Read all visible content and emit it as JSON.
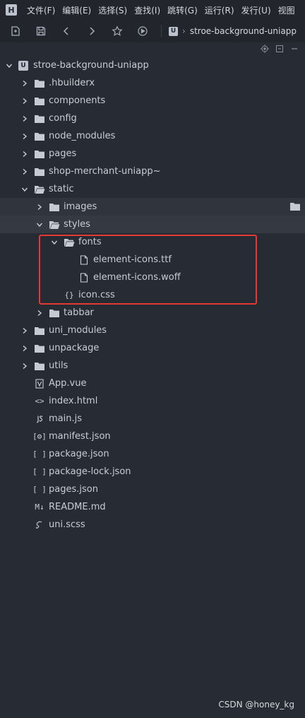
{
  "menu": {
    "logo_glyph": "H",
    "items": [
      "文件(F)",
      "编辑(E)",
      "选择(S)",
      "查找(I)",
      "跳转(G)",
      "运行(R)",
      "发行(U)",
      "视图"
    ]
  },
  "toolbar": {
    "buttons": [
      "new-file-icon",
      "save-icon",
      "back-icon",
      "forward-icon",
      "star-icon",
      "run-icon"
    ],
    "breadcrumb": {
      "badge": "U",
      "path": "stroe-background-uniapp"
    }
  },
  "panel_actions": [
    "locate-icon",
    "collapse-icon",
    "minimize-icon"
  ],
  "tree": {
    "root": {
      "badge": "U",
      "label": "stroe-background-uniapp"
    },
    "items": [
      {
        "label": ".hbuilderx",
        "type": "folder",
        "depth": 1,
        "state": "closed"
      },
      {
        "label": "components",
        "type": "folder",
        "depth": 1,
        "state": "closed"
      },
      {
        "label": "config",
        "type": "folder",
        "depth": 1,
        "state": "closed"
      },
      {
        "label": "node_modules",
        "type": "folder",
        "depth": 1,
        "state": "closed"
      },
      {
        "label": "pages",
        "type": "folder",
        "depth": 1,
        "state": "closed"
      },
      {
        "label": "shop-merchant-uniapp~",
        "type": "folder",
        "depth": 1,
        "state": "closed"
      },
      {
        "label": "static",
        "type": "folder",
        "depth": 1,
        "state": "open"
      },
      {
        "label": "images",
        "type": "folder",
        "depth": 2,
        "state": "closed"
      },
      {
        "label": "styles",
        "type": "folder",
        "depth": 2,
        "state": "open"
      },
      {
        "label": "fonts",
        "type": "folder",
        "depth": 3,
        "state": "open"
      },
      {
        "label": "element-icons.ttf",
        "type": "file",
        "depth": 4
      },
      {
        "label": "element-icons.woff",
        "type": "file",
        "depth": 4
      },
      {
        "label": "icon.css",
        "type": "css",
        "depth": 3,
        "glyph": "{}"
      },
      {
        "label": "tabbar",
        "type": "folder",
        "depth": 2,
        "state": "closed"
      },
      {
        "label": "uni_modules",
        "type": "folder",
        "depth": 1,
        "state": "closed"
      },
      {
        "label": "unpackage",
        "type": "folder",
        "depth": 1,
        "state": "closed"
      },
      {
        "label": "utils",
        "type": "folder",
        "depth": 1,
        "state": "closed"
      },
      {
        "label": "App.vue",
        "type": "vue",
        "depth": 1
      },
      {
        "label": "index.html",
        "type": "html",
        "depth": 1,
        "glyph": "<>"
      },
      {
        "label": "main.js",
        "type": "js",
        "depth": 1
      },
      {
        "label": "manifest.json",
        "type": "manifest",
        "depth": 1,
        "glyph": "[⚙]"
      },
      {
        "label": "package.json",
        "type": "json",
        "depth": 1,
        "glyph": "[ ]"
      },
      {
        "label": "package-lock.json",
        "type": "json",
        "depth": 1,
        "glyph": "[ ]"
      },
      {
        "label": "pages.json",
        "type": "json",
        "depth": 1,
        "glyph": "[ ]"
      },
      {
        "label": "README.md",
        "type": "md",
        "depth": 1,
        "glyph": "M↓"
      },
      {
        "label": "uni.scss",
        "type": "scss",
        "depth": 1
      }
    ]
  },
  "watermark": "CSDN @honey_kg",
  "colors": {
    "background": "#272b33",
    "highlight": "#e53935"
  }
}
